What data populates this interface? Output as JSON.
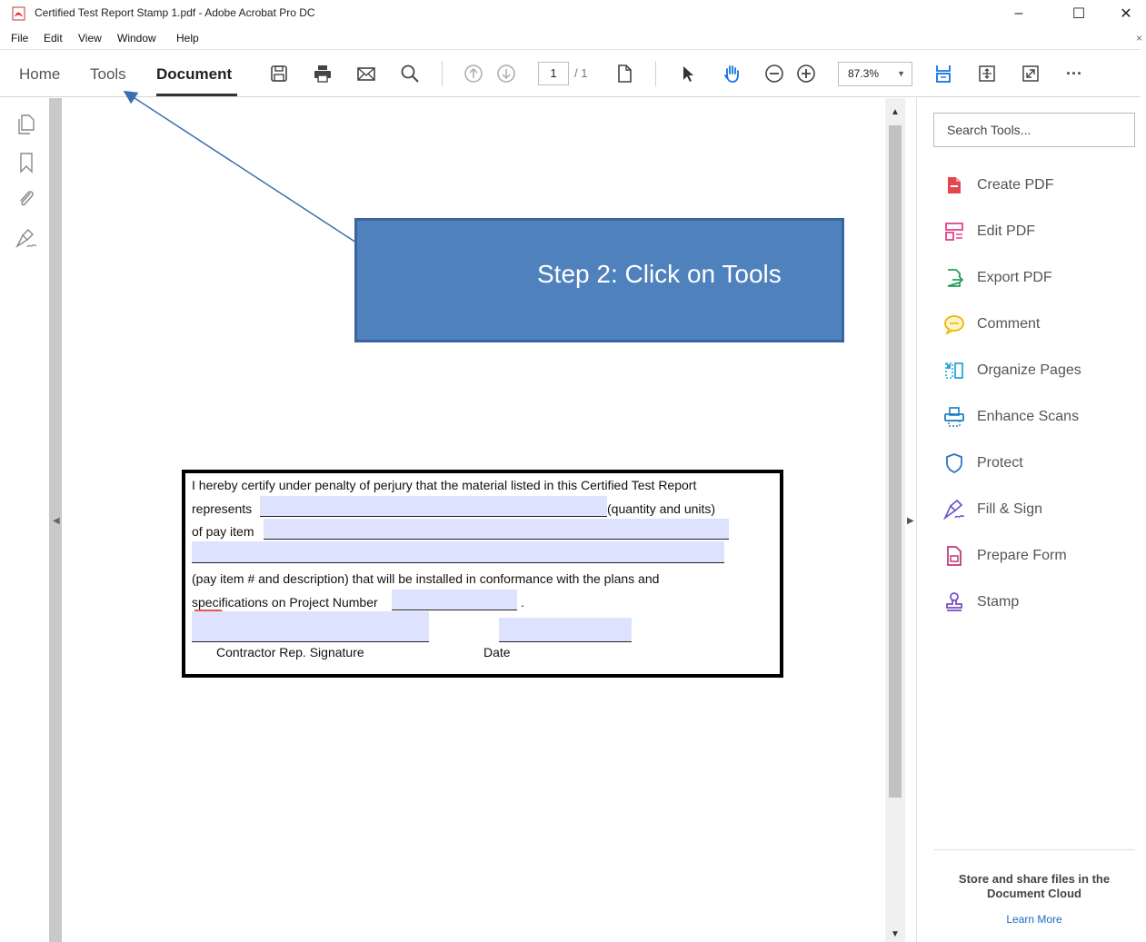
{
  "window": {
    "title": "Certified Test Report Stamp 1.pdf - Adobe Acrobat Pro DC",
    "minimize": "–",
    "maximize": "☐",
    "close": "✕"
  },
  "menu": {
    "items": [
      "File",
      "Edit",
      "View",
      "Window",
      "Help"
    ],
    "close": "×"
  },
  "toolbar": {
    "tabs": [
      "Home",
      "Tools",
      "Document"
    ],
    "active_tab": "Document",
    "page_current": "1",
    "page_total": "/ 1",
    "zoom": "87.3%",
    "more": "···"
  },
  "callout": {
    "text": "Step 2: Click on Tools",
    "color": "#4f81bd"
  },
  "form": {
    "line1": "I hereby certify under penalty of perjury that the material listed in this Certified Test Report",
    "line2_prefix": "represents",
    "line2_suffix": "(quantity and units)",
    "line3_prefix": "of pay item",
    "line5": "(pay item # and description)  that will be installed in conformance with the plans and",
    "line6_prefix": "specifications on Project Number",
    "line6_suffix": ".",
    "signature_label": "Contractor Rep. Signature",
    "date_label": "Date"
  },
  "right_panel": {
    "search_placeholder": "Search Tools...",
    "tools": [
      {
        "label": "Create PDF",
        "icon": "create-pdf-icon",
        "color": "#e34850"
      },
      {
        "label": "Edit PDF",
        "icon": "edit-pdf-icon",
        "color": "#e5408a"
      },
      {
        "label": "Export PDF",
        "icon": "export-pdf-icon",
        "color": "#2a9d5c"
      },
      {
        "label": "Comment",
        "icon": "comment-icon",
        "color": "#f0b400"
      },
      {
        "label": "Organize Pages",
        "icon": "organize-pages-icon",
        "color": "#29a8d8"
      },
      {
        "label": "Enhance Scans",
        "icon": "enhance-scans-icon",
        "color": "#1a7fc1"
      },
      {
        "label": "Protect",
        "icon": "protect-icon",
        "color": "#2f72c8"
      },
      {
        "label": "Fill & Sign",
        "icon": "fill-sign-icon",
        "color": "#6b4fc8"
      },
      {
        "label": "Prepare Form",
        "icon": "prepare-form-icon",
        "color": "#c23a74"
      },
      {
        "label": "Stamp",
        "icon": "stamp-icon",
        "color": "#7a4fc8"
      }
    ],
    "cloud_text": "Store and share files in the Document Cloud",
    "learn_more": "Learn More"
  }
}
